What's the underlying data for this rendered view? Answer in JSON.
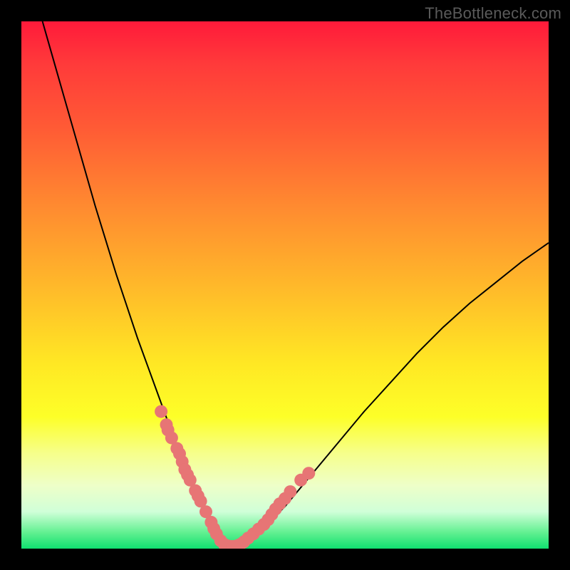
{
  "watermark": "TheBottleneck.com",
  "chart_data": {
    "type": "line",
    "title": "",
    "xlabel": "",
    "ylabel": "",
    "xlim": [
      0,
      100
    ],
    "ylim": [
      0,
      100
    ],
    "series": [
      {
        "name": "curve",
        "x": [
          4,
          6,
          8,
          10,
          12,
          14,
          16,
          18,
          20,
          22,
          24,
          26,
          28,
          30,
          32,
          34,
          36,
          37.8,
          40,
          45,
          50,
          55,
          60,
          65,
          70,
          75,
          80,
          85,
          90,
          95,
          100
        ],
        "y": [
          100,
          93,
          86,
          79,
          72,
          65,
          58.5,
          52,
          46,
          40,
          34.5,
          29,
          23.5,
          18,
          13,
          9,
          5,
          2.5,
          0.5,
          3,
          8,
          14,
          20,
          26,
          31.5,
          37,
          42,
          46.5,
          50.5,
          54.5,
          58
        ]
      },
      {
        "name": "markers",
        "x": [
          26.5,
          27.5,
          27.8,
          28.5,
          29.5,
          30,
          30.5,
          31,
          31.5,
          32,
          33,
          33.5,
          34,
          35,
          36,
          36.5,
          37,
          37.8,
          38.5,
          39.2,
          40,
          40.8,
          41.5,
          42.2,
          43,
          44,
          45,
          46,
          46.8,
          47.5,
          48.2,
          49,
          50,
          51,
          53,
          54.5
        ],
        "y": [
          26,
          23.5,
          22.5,
          21,
          19,
          18,
          16.5,
          15,
          14,
          13,
          11,
          10,
          9,
          7,
          5,
          3.8,
          2.8,
          1.5,
          0.8,
          0.5,
          0.4,
          0.5,
          0.8,
          1.3,
          2,
          2.8,
          3.7,
          4.6,
          5.5,
          6.5,
          7.5,
          8.5,
          9.5,
          10.8,
          13,
          14.3
        ]
      }
    ],
    "marker_color": "#e77575",
    "marker_radius_px": 9
  }
}
